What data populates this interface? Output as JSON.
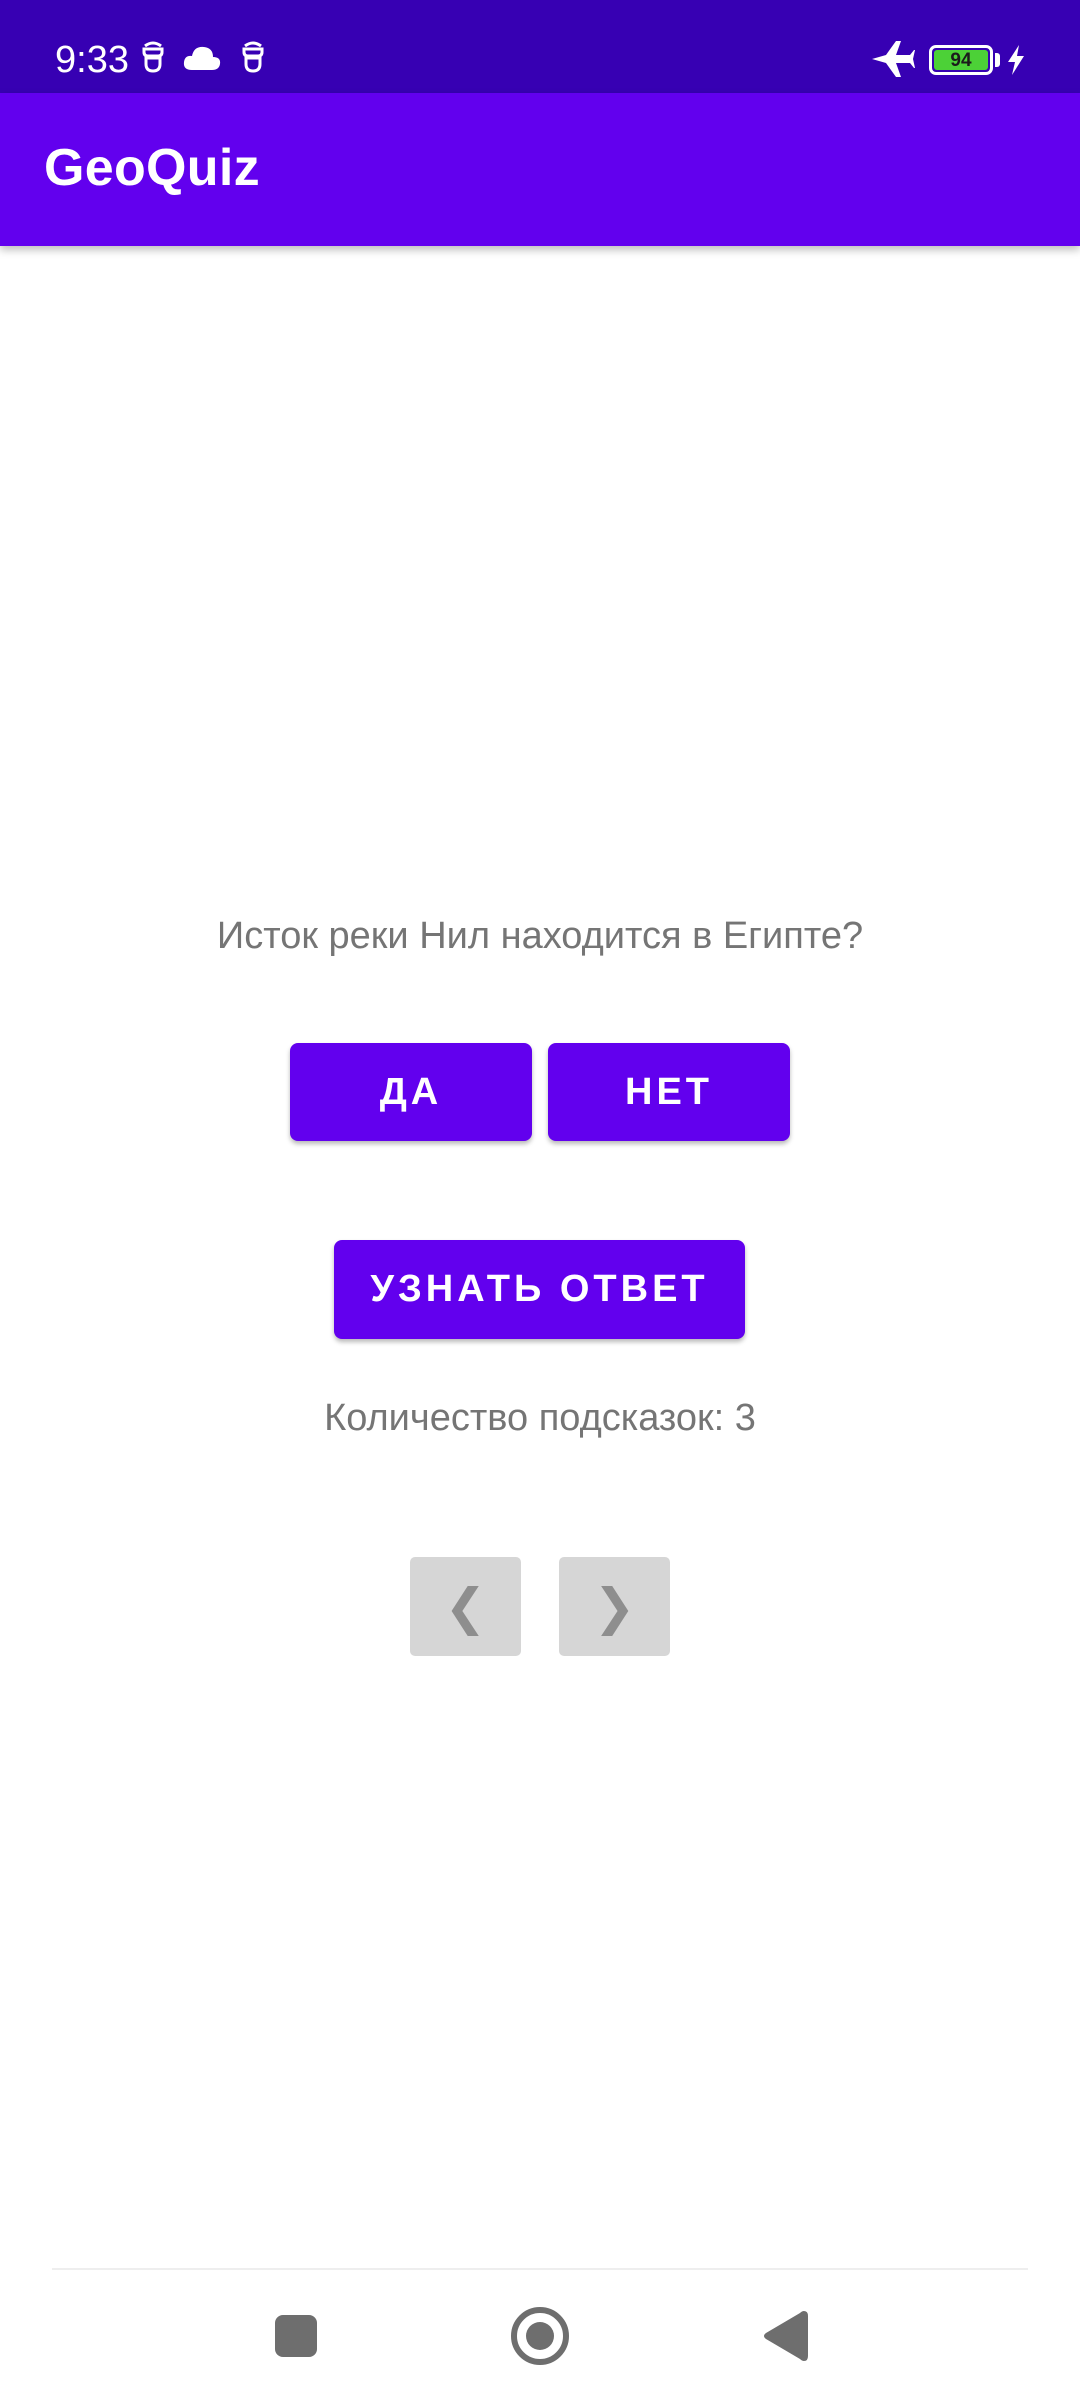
{
  "status_bar": {
    "time": "9:33",
    "battery_level": "94",
    "icons": [
      "notification-icon",
      "cloud-icon",
      "notification-icon",
      "airplane-mode-icon",
      "battery-icon",
      "charging-icon"
    ]
  },
  "app_bar": {
    "title": "GeoQuiz",
    "background": "#6200ee"
  },
  "quiz": {
    "question": "Исток реки Нил находится в Египте?",
    "true_button": "ДА",
    "false_button": "НЕТ",
    "cheat_button": "УЗНАТЬ ОТВЕТ",
    "hints_remaining": "Количество подсказок: 3",
    "prev_button": "❮",
    "next_button": "❯"
  },
  "colors": {
    "primary": "#6200ee",
    "primary_dark": "#3700b3",
    "text_secondary": "#757575",
    "nav_button": "#d6d6d6"
  },
  "system_nav": {
    "buttons": [
      "recent-apps-icon",
      "home-icon",
      "back-icon"
    ]
  }
}
